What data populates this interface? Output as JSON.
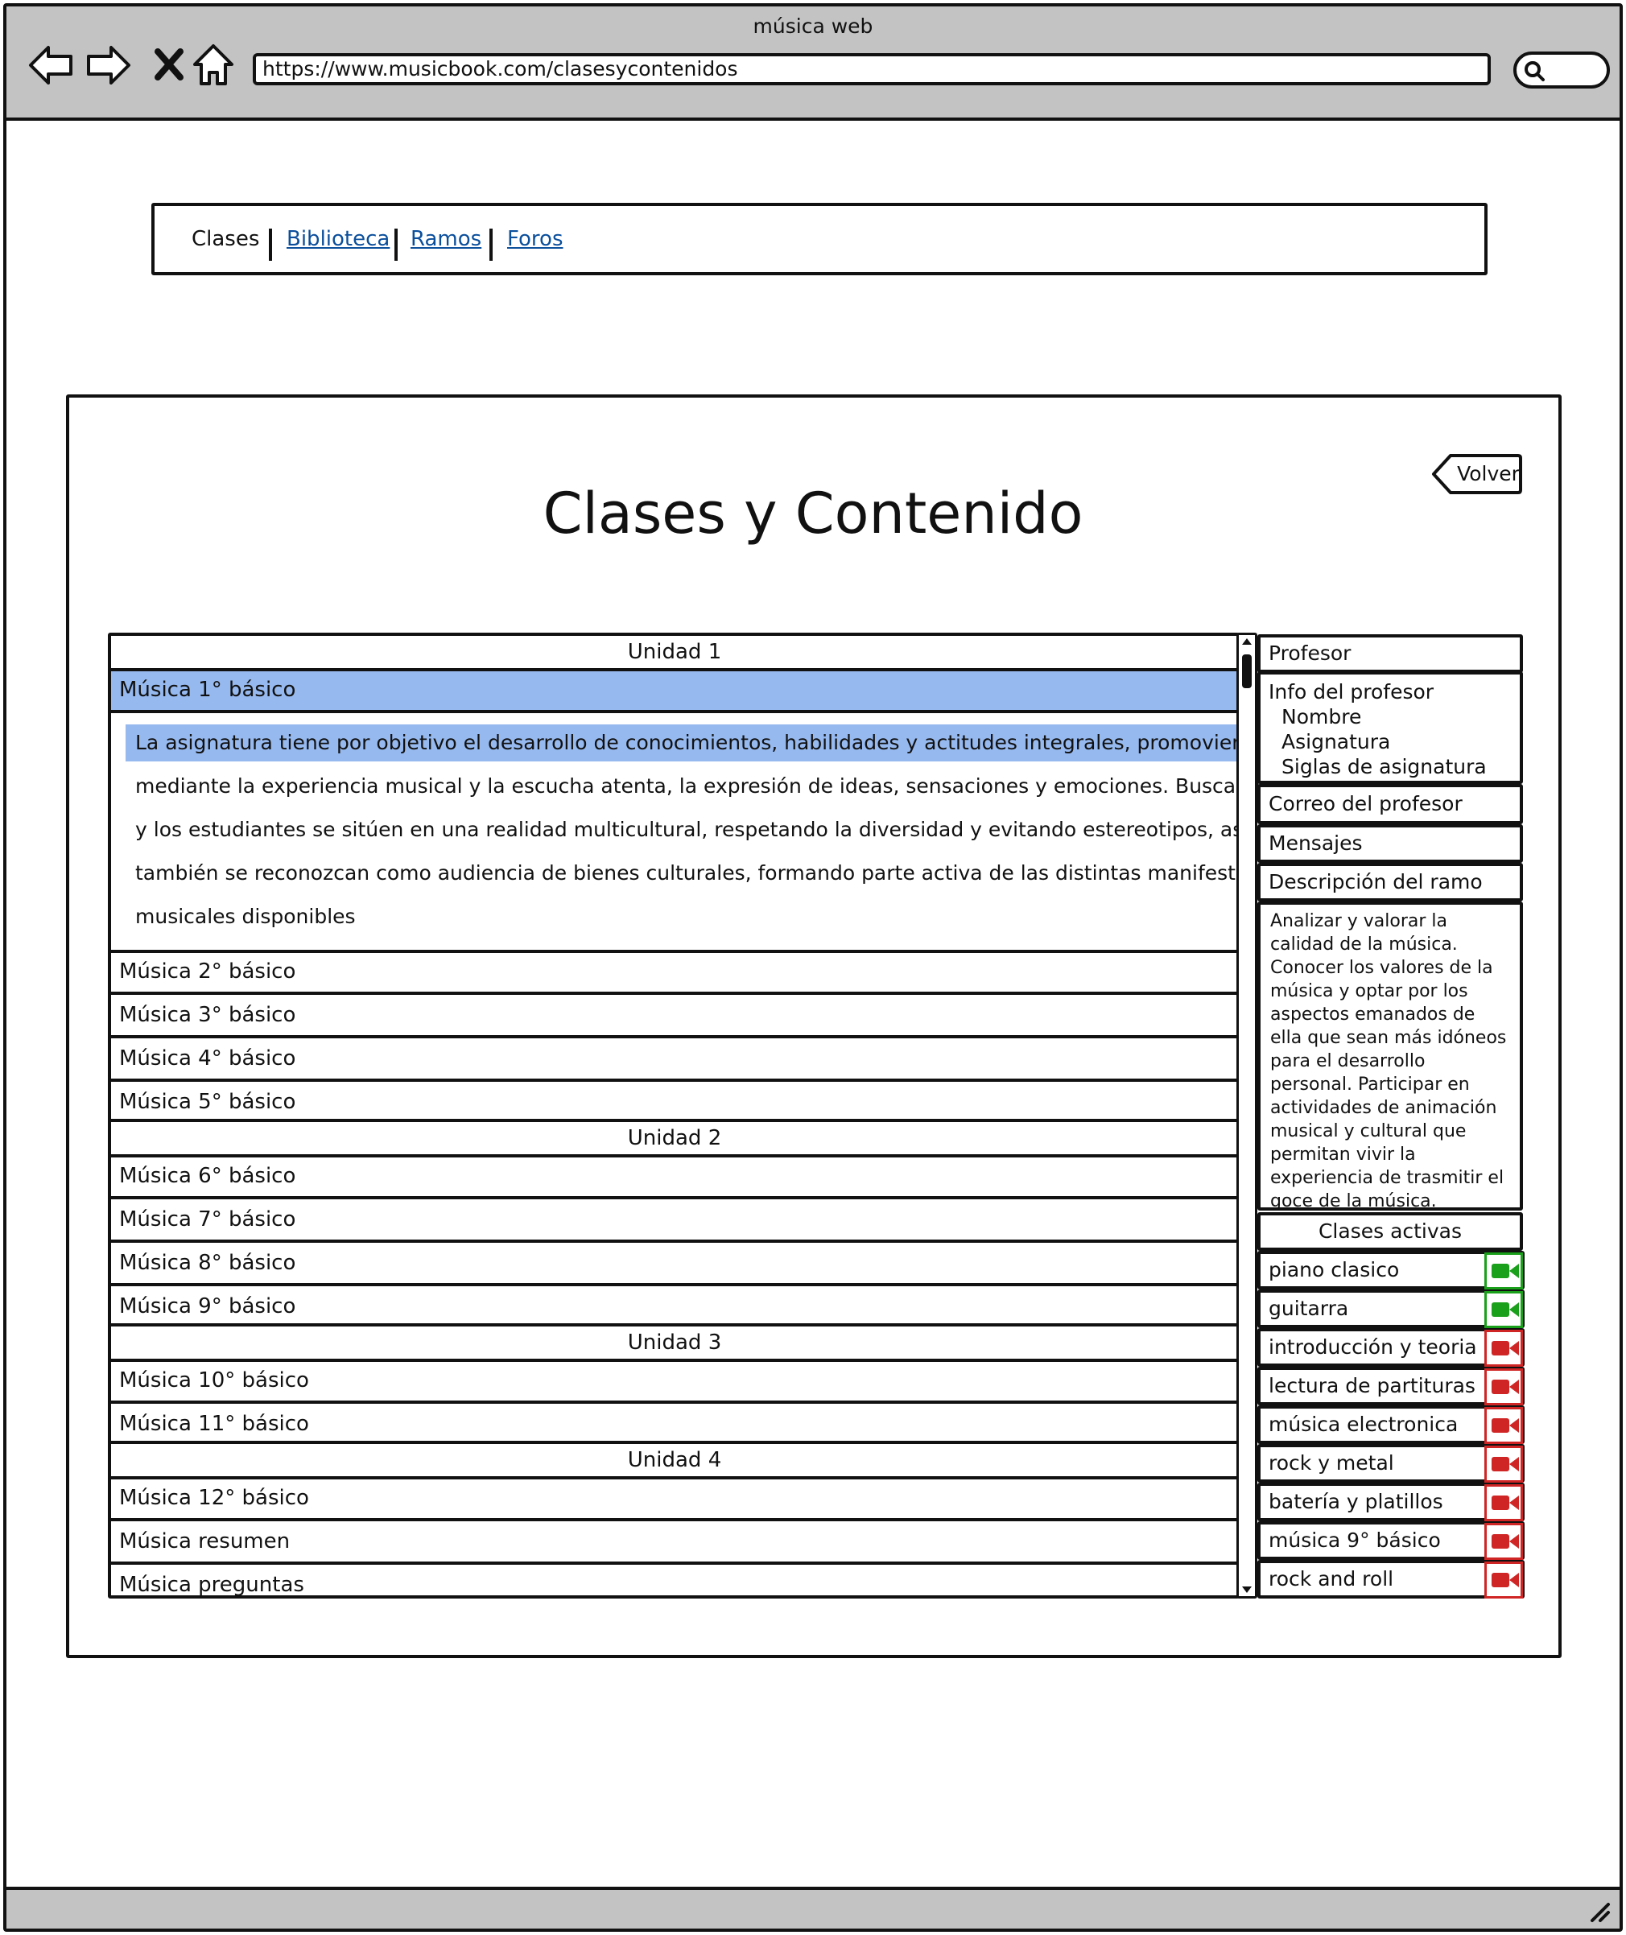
{
  "browser": {
    "window_title": "música web",
    "url": "https://www.musicbook.com/clasesycontenidos"
  },
  "nav": {
    "items": [
      {
        "label": "Clases"
      },
      {
        "label": "Biblioteca"
      },
      {
        "label": "Ramos"
      },
      {
        "label": "Foros"
      }
    ]
  },
  "page": {
    "title": "Clases y Contenido",
    "back_label": "Volver"
  },
  "list": {
    "units": [
      "Unidad 1",
      "Unidad 2",
      "Unidad 3",
      "Unidad 4"
    ],
    "items": [
      "Música 1° básico",
      "Música 2° básico",
      "Música 3° básico",
      "Música 4° básico",
      "Música 5° básico",
      "Música 6° básico",
      "Música 7° básico",
      "Música 8° básico",
      "Música 9° básico",
      "Música 10° básico",
      "Música 11° básico",
      "Música 12° básico",
      "Música resumen",
      "Música preguntas"
    ],
    "selected_description": [
      "La asignatura tiene por objetivo el desarrollo de conocimientos, habilidades y actitudes integrales, promoviendo,",
      "mediante la experiencia musical y la escucha atenta, la expresión de ideas, sensaciones y emociones. Busca que las",
      "y los estudiantes se sitúen en una realidad multicultural, respetando la diversidad y evitando estereotipos, así como",
      "también se reconozcan como audiencia de bienes culturales, formando parte activa de las distintas manifestaciones",
      "musicales disponibles"
    ]
  },
  "sidebar": {
    "profesor": "Profesor",
    "info_title": "Info del profesor",
    "info_fields": [
      "Nombre",
      "Asignatura",
      "Siglas de asignatura"
    ],
    "correo": "Correo del profesor",
    "mensajes": "Mensajes",
    "descripcion_title": "Descripción del ramo",
    "descripcion_text": "Analizar y valorar la calidad de la música. Conocer los valores de la música y optar por los aspectos emanados de ella que sean más idóneos para el desarrollo personal. Participar en actividades de animación musical y cultural que permitan vivir la experiencia de trasmitir el goce de la música.",
    "clases_title": "Clases activas",
    "clases": [
      {
        "label": "piano clasico",
        "status": "active"
      },
      {
        "label": "guitarra",
        "status": "active"
      },
      {
        "label": "introducción y teoria",
        "status": "inactive"
      },
      {
        "label": "lectura de partituras",
        "status": "inactive"
      },
      {
        "label": "música electronica",
        "status": "inactive"
      },
      {
        "label": "rock y metal",
        "status": "inactive"
      },
      {
        "label": "batería y platillos",
        "status": "inactive"
      },
      {
        "label": "música 9° básico",
        "status": "inactive"
      },
      {
        "label": "rock and roll",
        "status": "inactive"
      }
    ]
  },
  "colors": {
    "selection": "#96b9ef",
    "link": "#0b4f9c",
    "camera_active": "#1aa01a",
    "camera_inactive": "#d02525",
    "chrome": "#c3c3c3"
  },
  "icons": [
    "back-arrow-icon",
    "forward-arrow-icon",
    "close-icon",
    "home-icon",
    "search-icon",
    "video-camera-icon",
    "resize-handle-icon"
  ]
}
